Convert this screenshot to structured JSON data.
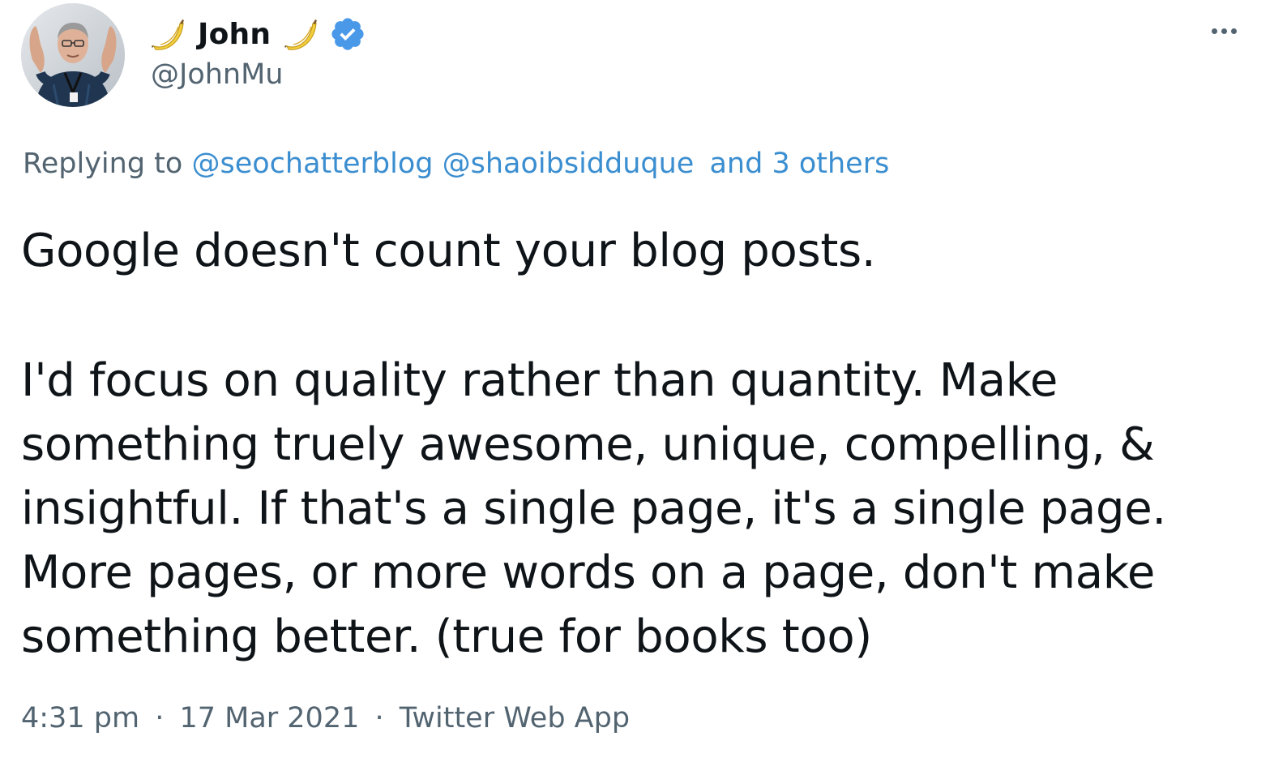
{
  "author": {
    "name": "John",
    "handle": "@JohnMu",
    "name_prefix_emoji": "🍌",
    "name_suffix_emoji": "🍌",
    "verified_icon": "verified-badge-icon",
    "verified_color": "#4a99e9"
  },
  "more_icon": "more-horizontal-icon",
  "replying": {
    "prefix": "Replying to",
    "handle_1": "@seochatterblog",
    "handle_2": "@shaoibsidduque",
    "others": "and 3 others"
  },
  "tweet": {
    "lines_1": [
      "Google doesn't count your blog posts."
    ],
    "lines_2": [
      "I'd focus on quality rather than quantity. Make",
      "something truely awesome, unique, compelling, &",
      "insightful. If that's a single page, it's a single page.",
      "More pages, or more words on a page, don't make",
      "something better.  (true for books too)"
    ]
  },
  "meta": {
    "time": "4:31 pm",
    "separator": "·",
    "date": "17 Mar 2021",
    "source": "Twitter Web App"
  },
  "colors": {
    "text": "#0f1419",
    "secondary": "#536471",
    "link": "#3b8ed0"
  }
}
